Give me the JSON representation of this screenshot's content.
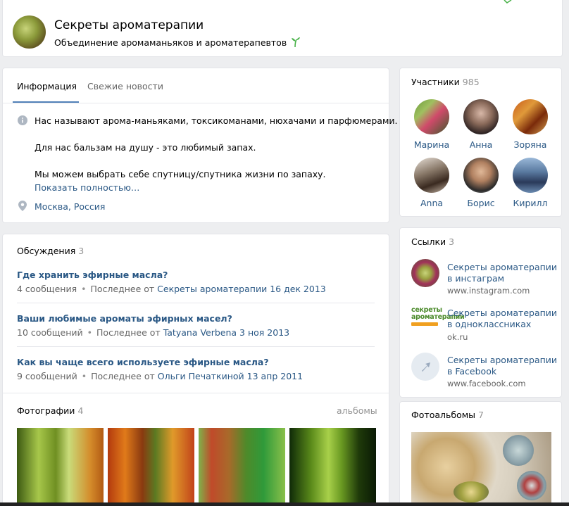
{
  "header": {
    "title": "Секреты ароматерапии",
    "status": "Объединение аромаманьяков и ароматерапевтов"
  },
  "tabs": [
    {
      "label": "Информация"
    },
    {
      "label": "Свежие новости"
    }
  ],
  "info": {
    "lines": [
      "Нас называют арома-маньяками, токсикоманами, нюхачами и парфюмерами.",
      "Для нас бальзам на душу - это любимый запах.",
      "Мы можем выбрать себе спутницу/спутника жизни по запаху."
    ],
    "show_more": "Показать полностью…",
    "location": "Москва, Россия"
  },
  "discussions": {
    "title": "Обсуждения",
    "count": "3",
    "topics": [
      {
        "title": "Где хранить эфирные масла?",
        "posts": "4 сообщения",
        "last_prefix": "Последнее от",
        "author": "Секреты ароматерапии",
        "date": "16 дек 2013"
      },
      {
        "title": "Ваши любимые ароматы эфирных масел?",
        "posts": "10 сообщений",
        "last_prefix": "Последнее от",
        "author": "Tatyana Verbena",
        "date": "3 ноя 2013"
      },
      {
        "title": "Как вы чаще всего используете эфирные масла?",
        "posts": "9 сообщений",
        "last_prefix": "Последнее от",
        "author": "Ольги Печаткиной",
        "date": "13 апр 2011"
      }
    ]
  },
  "photos": {
    "title": "Фотографии",
    "count": "4",
    "albums_link": "альбомы"
  },
  "members": {
    "title": "Участники",
    "count": "985",
    "list": [
      {
        "name": "Марина"
      },
      {
        "name": "Анна"
      },
      {
        "name": "Зоряна"
      },
      {
        "name": "Anna"
      },
      {
        "name": "Борис"
      },
      {
        "name": "Кирилл"
      }
    ]
  },
  "links": {
    "title": "Ссылки",
    "count": "3",
    "list": [
      {
        "line1": "Секреты ароматерапии",
        "line2": "в инстаграм",
        "url": "www.instagram.com"
      },
      {
        "line1": "Секреты ароматерапии",
        "line2": "в одноклассниках",
        "url": "ok.ru"
      },
      {
        "line1": "Секреты ароматерапии",
        "line2": "в Facebook",
        "url": "www.facebook.com"
      }
    ],
    "ok_logo_text": "секреты ароматерапии"
  },
  "albums": {
    "title": "Фотоальбомы",
    "count": "7"
  },
  "colors": {
    "link": "#2a5885",
    "accent": "#5181b8",
    "background": "#edeef0",
    "muted": "#939393"
  }
}
